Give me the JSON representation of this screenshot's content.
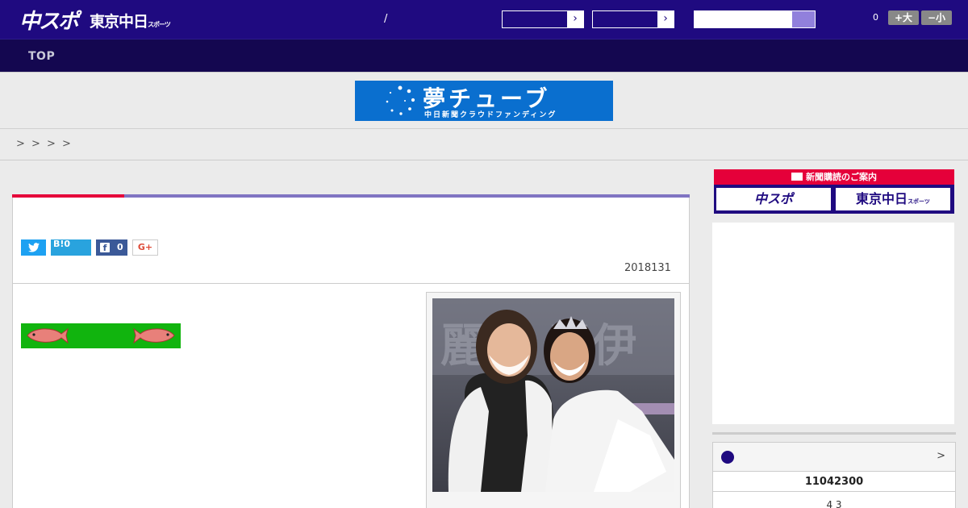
{
  "header": {
    "logo_chuspo": "中スポ",
    "logo_tokyo": "東京中日",
    "logo_tokyo_small": "スポーツ",
    "slash": "/",
    "font_count": "0",
    "font_large": "+大",
    "font_small": "−小"
  },
  "nav": {
    "top": "TOP"
  },
  "banner": {
    "title": "夢チューブ",
    "subtitle": "中日新聞クラウドファンディング"
  },
  "breadcrumb": [
    ">",
    ">",
    ">",
    ">"
  ],
  "article": {
    "share": {
      "twitter": "",
      "hatena": "B!0",
      "facebook_count": "0",
      "gplus": "G+"
    },
    "date": "2018131"
  },
  "sidebar": {
    "subscribe_head": "新聞購読のご案内",
    "subscribe_chuspo": "中スポ",
    "subscribe_tokyo": "東京中日",
    "subscribe_tokyo_small": "スポーツ",
    "widget_more": ">",
    "widget_score": "11042300",
    "widget_line": "4  3"
  },
  "colors": {
    "header": "#1f0a80",
    "nav": "#140750",
    "accent_red": "#e5003a",
    "accent_purple": "#8074c2",
    "banner_blue": "#0a6fcf",
    "fish_green": "#11b40e"
  }
}
